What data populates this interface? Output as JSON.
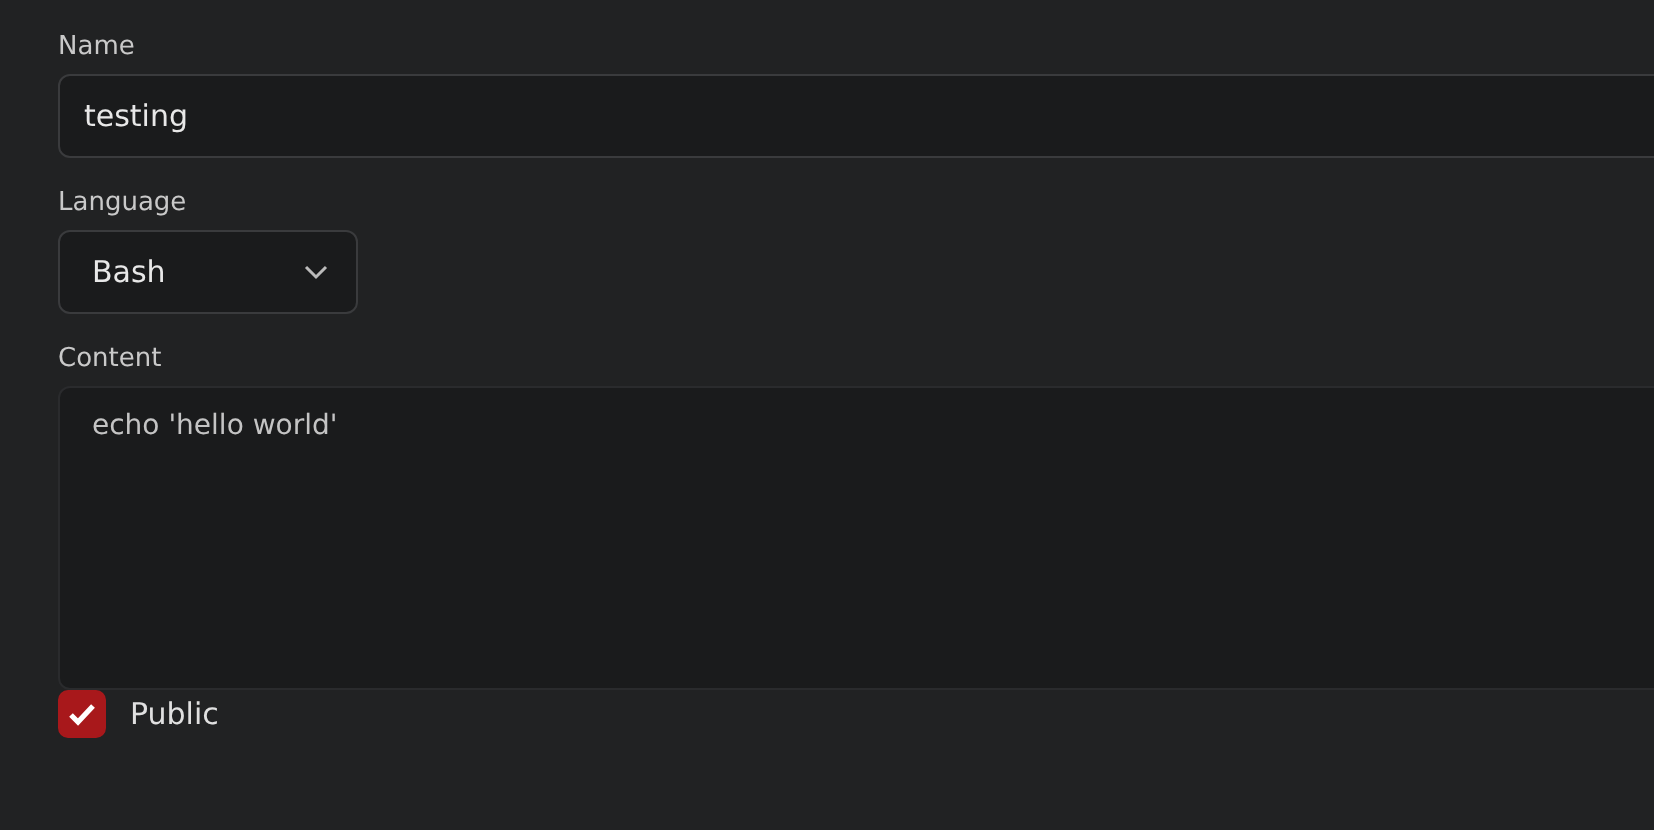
{
  "fields": [
    {
      "kind": "text",
      "label": "Name",
      "value": "testing"
    },
    {
      "kind": "select",
      "label": "Language",
      "value": "Bash"
    },
    {
      "kind": "textarea",
      "label": "Content",
      "value": "echo 'hello world'"
    }
  ],
  "public": {
    "label": "Public",
    "checked": true
  }
}
